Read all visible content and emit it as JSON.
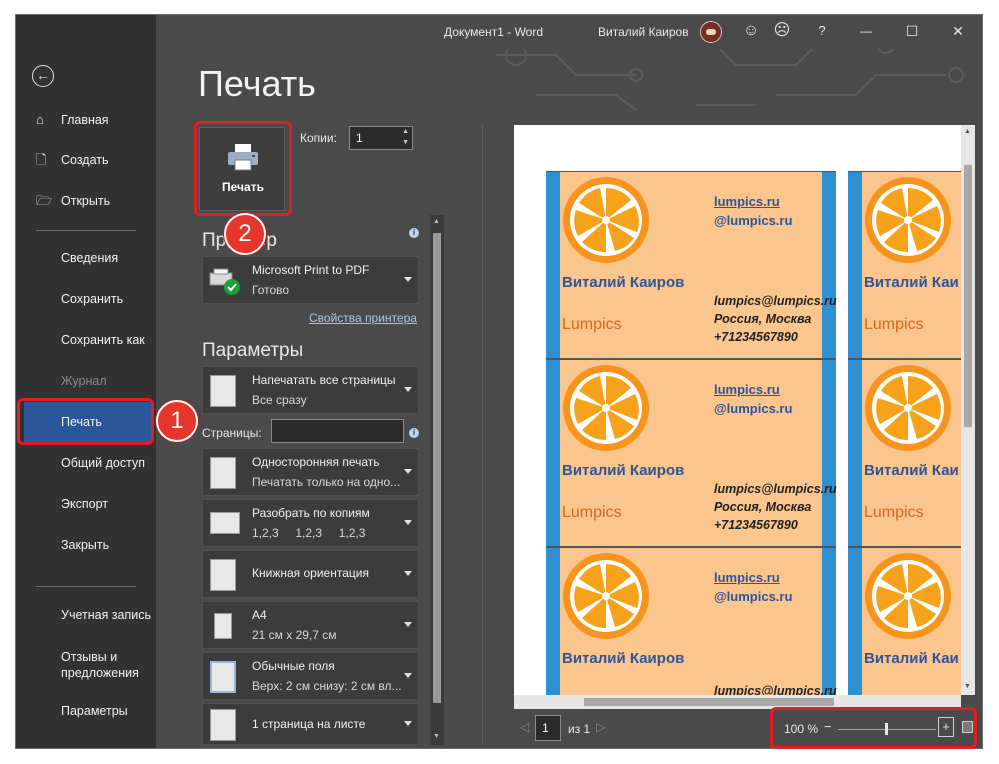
{
  "window": {
    "title": "Документ1 - Word",
    "user": "Виталий Каиров",
    "buttons": [
      "smiley-icon",
      "frown-icon",
      "help-icon",
      "minimize-icon",
      "maximize-icon",
      "close-icon"
    ],
    "help_glyph": "?",
    "close_glyph": "✕",
    "min_glyph": "—",
    "max_glyph": "☐"
  },
  "sidebar": {
    "back_glyph": "←",
    "top_items": [
      {
        "label": "Главная",
        "icon": "home-icon"
      },
      {
        "label": "Создать",
        "icon": "new-document-icon"
      },
      {
        "label": "Открыть",
        "icon": "folder-icon"
      }
    ],
    "items": [
      {
        "label": "Сведения"
      },
      {
        "label": "Сохранить"
      },
      {
        "label": "Сохранить как"
      },
      {
        "label": "Журнал",
        "disabled": true
      },
      {
        "label": "Печать",
        "active": true
      },
      {
        "label": "Общий доступ"
      },
      {
        "label": "Экспорт"
      },
      {
        "label": "Закрыть"
      }
    ],
    "bottom_items": [
      {
        "label": "Учетная запись"
      },
      {
        "label": "Отзывы и"
      },
      {
        "label": "предложения"
      },
      {
        "label": "Параметры"
      }
    ]
  },
  "print": {
    "heading": "Печать",
    "button_label": "Печать",
    "copies_label": "Копии:",
    "copies_value": "1",
    "printer_heading": "Принтер",
    "printer_name": "Microsoft Print to PDF",
    "printer_status": "Готово",
    "printer_properties": "Свойства принтера",
    "params_heading": "Параметры",
    "pages_label": "Страницы:",
    "info_glyph": "i",
    "settings": [
      {
        "line1": "Напечатать все страницы",
        "line2": "Все сразу"
      },
      {
        "line1": "Односторонняя печать",
        "line2": "Печатать только на одно..."
      },
      {
        "line1": "Разобрать по копиям",
        "line2": "1,2,3     1,2,3     1,2,3"
      },
      {
        "line1": "Книжная ориентация",
        "line2": ""
      },
      {
        "line1": "A4",
        "line2": "21 см x 29,7 см"
      },
      {
        "line1": "Обычные поля",
        "line2": "Верх: 2 см снизу: 2 см вл..."
      },
      {
        "line1": "1 страница на листе",
        "line2": ""
      }
    ]
  },
  "preview": {
    "cards": [
      {
        "site": "lumpics.ru",
        "site2": "@lumpics.ru",
        "name": "Виталий Каиров",
        "brand": "Lumpics",
        "email": "lumpics@lumpics.ru",
        "city": "Россия, Москва",
        "phone": "+71234567890"
      }
    ],
    "side_name": "Виталий Каи",
    "side_brand": "Lumpics",
    "colors": {
      "card_bg": "#fbc58e",
      "side_bar": "#2f8fd3",
      "orange": "#f79a1c",
      "name": "#2f5597",
      "brand": "#d06a1c"
    }
  },
  "footer": {
    "page_value": "1",
    "page_of": "из 1",
    "zoom": "100 %",
    "zoom_minus": "−",
    "zoom_plus": "+"
  },
  "callouts": {
    "badge1": "1",
    "badge2": "2",
    "color": "#e01e26"
  }
}
